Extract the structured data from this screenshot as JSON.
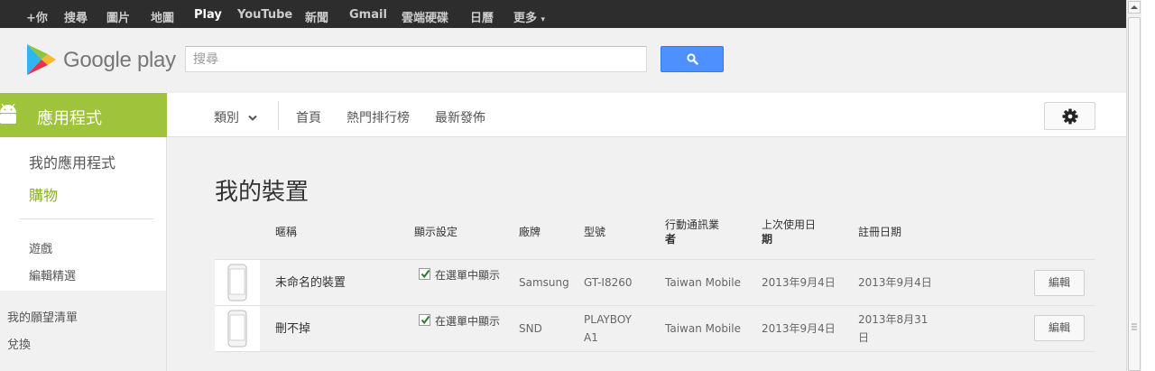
{
  "topbar": {
    "items": [
      {
        "label": "+你",
        "active": false
      },
      {
        "label": "搜尋",
        "active": false
      },
      {
        "label": "圖片",
        "active": false
      },
      {
        "label": "地圖",
        "active": false
      },
      {
        "label": "Play",
        "active": true
      },
      {
        "label": "YouTube",
        "active": false
      },
      {
        "label": "新聞",
        "active": false
      },
      {
        "label": "Gmail",
        "active": false
      },
      {
        "label": "雲端硬碟",
        "active": false
      },
      {
        "label": "日曆",
        "active": false
      },
      {
        "label": "更多",
        "active": false
      }
    ],
    "more_caret": "▾"
  },
  "header": {
    "logo_text": "Google play",
    "search_placeholder": "搜尋",
    "search_icon": "search-icon"
  },
  "nav": {
    "apps_tab_label": "應用程式",
    "category_label": "類別",
    "links": [
      "首頁",
      "熱門排行榜",
      "最新發佈"
    ],
    "settings_icon": "gear-icon"
  },
  "sidebar": {
    "my_apps": "我的應用程式",
    "shop": "購物",
    "games": "遊戲",
    "editors_choice": "編輯精選",
    "wishlist": "我的願望清單",
    "redeem": "兌換"
  },
  "colors": {
    "apps_green": "#9fc33b",
    "topbar": "#2d2d2d",
    "search_blue": "#4d90fe"
  },
  "main": {
    "title": "我的裝置",
    "columns": {
      "nickname": "暱稱",
      "display": "顯示設定",
      "brand": "廠牌",
      "model": "型號",
      "carrier_1": "行動通訊業",
      "carrier_2": "者",
      "last_used_1": "上次使用日",
      "last_used_2": "期",
      "registered": "註冊日期"
    },
    "devices": [
      {
        "nickname": "未命名的裝置",
        "display_text": "在選單中顯示",
        "display_checked": true,
        "brand": "Samsung",
        "model": "GT-I8260",
        "carrier": "Taiwan Mobile",
        "last_used": "2013年9月4日",
        "registered": "2013年9月4日",
        "edit_label": "編輯"
      },
      {
        "nickname": "刪不掉",
        "display_text": "在選單中顯示",
        "display_checked": true,
        "brand": "SND",
        "model": "PLAYBOY A1",
        "carrier": "Taiwan Mobile",
        "last_used": "2013年9月4日",
        "registered": "2013年8月31日",
        "edit_label": "編輯"
      }
    ]
  }
}
